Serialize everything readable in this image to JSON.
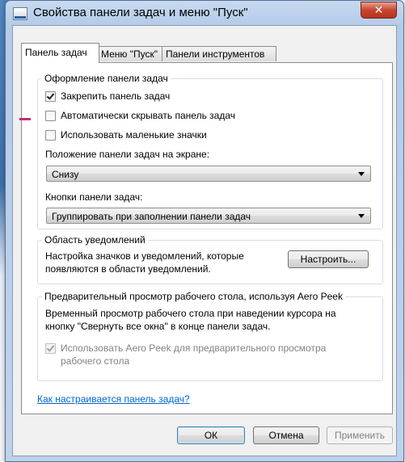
{
  "window": {
    "title": "Свойства панели задач и меню \"Пуск\"",
    "close_glyph": "✕"
  },
  "tabs": [
    {
      "label": "Панель задач",
      "active": true
    },
    {
      "label": "Меню \"Пуск\"",
      "active": false
    },
    {
      "label": "Панели инструментов",
      "active": false
    }
  ],
  "appearance": {
    "legend": "Оформление панели задач",
    "lock_taskbar": {
      "label": "Закрепить панель задач",
      "checked": true
    },
    "auto_hide": {
      "label": "Автоматически скрывать панель задач",
      "checked": false
    },
    "small_icons": {
      "label": "Использовать маленькие значки",
      "checked": false
    },
    "position_label": "Положение панели задач на экране:",
    "position_value": "Снизу",
    "buttons_label": "Кнопки панели задач:",
    "buttons_value": "Группировать при заполнении панели задач"
  },
  "notification": {
    "legend": "Область уведомлений",
    "text_line1": "Настройка значков и уведомлений, которые",
    "text_line2": "появляются в области уведомлений.",
    "customize_button": "Настроить..."
  },
  "aero_peek": {
    "legend": "Предварительный просмотр рабочего стола, используя Aero Peek",
    "text_line1": "Временный просмотр рабочего стола при наведении курсора на",
    "text_line2": "кнопку \"Свернуть все окна\" в конце панели задач.",
    "checkbox_line1": "Использовать Aero Peek для предварительного просмотра",
    "checkbox_line2": "рабочего стола",
    "checked": true,
    "enabled": false
  },
  "help_link": "Как настраивается панель задач?",
  "footer": {
    "ok": "ОК",
    "cancel": "Отмена",
    "apply": "Применить"
  }
}
